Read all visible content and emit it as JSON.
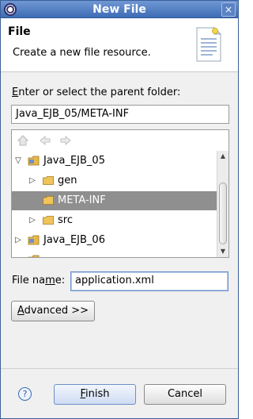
{
  "window": {
    "title": "New File",
    "close_glyph": "×"
  },
  "header": {
    "title": "File",
    "description": "Create a new file resource."
  },
  "parent_folder": {
    "label_prefix": "E",
    "label_rest": "nter or select the parent folder:",
    "value": "Java_EJB_05/META-INF"
  },
  "tree": {
    "toolbar": {
      "home_icon": "home-icon",
      "back_icon": "back-arrow-icon",
      "forward_icon": "forward-arrow-icon"
    },
    "items": [
      {
        "label": "Java_EJB_05",
        "expanded": true,
        "type": "project"
      },
      {
        "label": "gen",
        "expanded": false,
        "type": "folder"
      },
      {
        "label": "META-INF",
        "expanded": null,
        "type": "folder",
        "selected": true
      },
      {
        "label": "src",
        "expanded": false,
        "type": "folder"
      },
      {
        "label": "Java_EJB_06",
        "expanded": false,
        "type": "project"
      }
    ]
  },
  "file_name": {
    "label_prefix": "File na",
    "label_mnemonic": "m",
    "label_suffix": "e:",
    "value": "application.xml"
  },
  "buttons": {
    "advanced_prefix": "A",
    "advanced_rest": "dvanced >>",
    "finish_mnemonic": "F",
    "finish_rest": "inish",
    "cancel": "Cancel"
  },
  "help_glyph": "?",
  "colors": {
    "titlebar": "#4f7cc1",
    "selection": "#8f8f8f",
    "folder": "#e8b94a"
  }
}
